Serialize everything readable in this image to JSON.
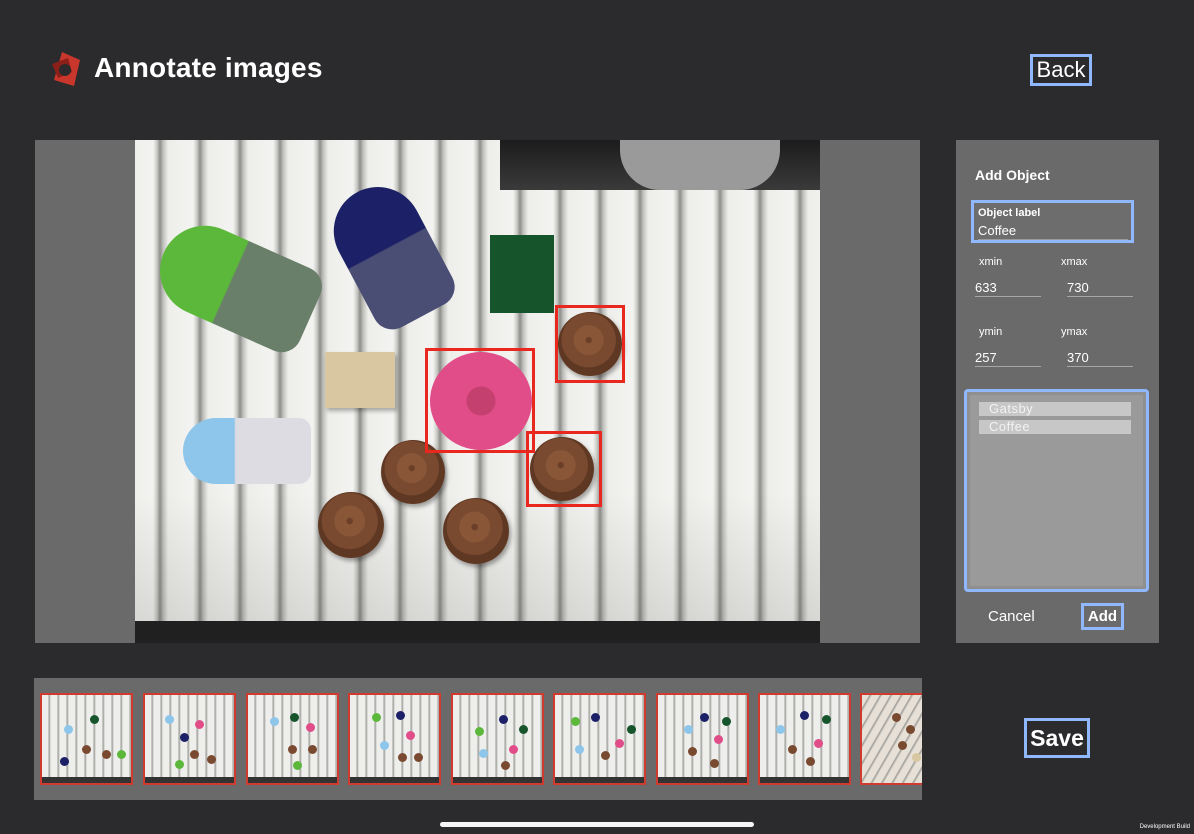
{
  "header": {
    "title": "Annotate images",
    "back_label": "Back",
    "logo_icon": "app-logo-icon"
  },
  "annotation": {
    "boxes": [
      {
        "label": "Gatsby",
        "shape": "pink-cap"
      },
      {
        "label": "Coffee",
        "shape": "brown-cap-upper"
      },
      {
        "label": "Coffee",
        "shape": "brown-cap-lower"
      }
    ],
    "box_color": "#e8281f"
  },
  "add_object": {
    "heading": "Add Object",
    "label_caption": "Object label",
    "label_value": "Coffee",
    "xmin_label": "xmin",
    "xmin_value": "633",
    "xmax_label": "xmax",
    "xmax_value": "730",
    "ymin_label": "ymin",
    "ymin_value": "257",
    "ymax_label": "ymax",
    "ymax_value": "370",
    "labels": [
      "Gatsby",
      "Coffee"
    ],
    "cancel_label": "Cancel",
    "add_label": "Add"
  },
  "thumbnails": {
    "count": 9
  },
  "footer": {
    "save_label": "Save",
    "dev_build": "Development Build"
  },
  "colors": {
    "background": "#2b2b2d",
    "panel": "#6a6a6a",
    "accent_outline": "#8fb8ff",
    "bbox": "#e8281f"
  }
}
